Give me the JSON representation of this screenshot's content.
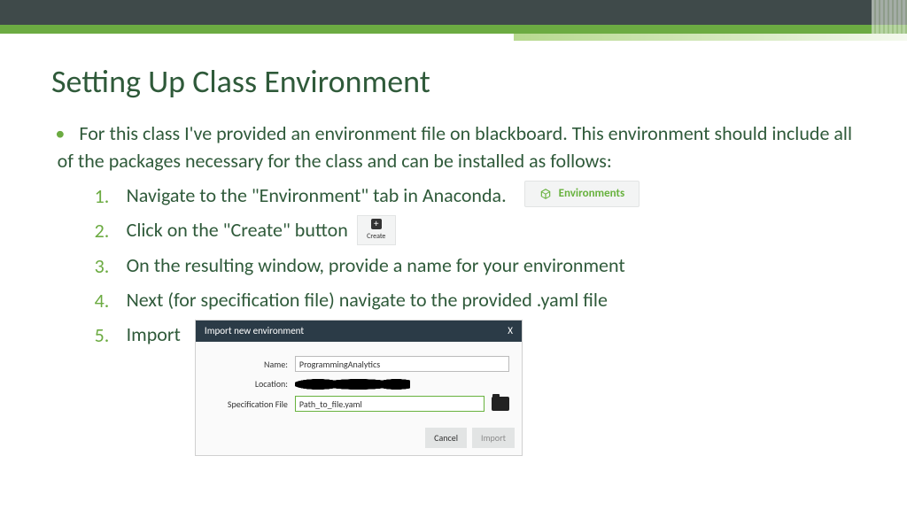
{
  "slide": {
    "title": "Setting Up Class Environment",
    "intro": "For this class I've provided an environment file on blackboard. This environment should include all of the packages necessary for the class and can be installed as follows:",
    "steps": {
      "s1": "Navigate to the \"Environment\" tab in Anaconda.",
      "s2": "Click on the \"Create\" button",
      "s3": "On the resulting window, provide a name for your environment",
      "s4": "Next (for specification file) navigate to the provided .yaml file",
      "s5": "Import"
    }
  },
  "screenshots": {
    "env_tab_label": "Environments",
    "create_label": "Create",
    "dialog": {
      "title": "Import new environment",
      "close": "X",
      "name_label": "Name:",
      "name_value": "ProgrammingAnalytics",
      "location_label": "Location:",
      "spec_label": "Specification File",
      "spec_value": "Path_to_file.yaml",
      "cancel": "Cancel",
      "import": "Import"
    }
  }
}
